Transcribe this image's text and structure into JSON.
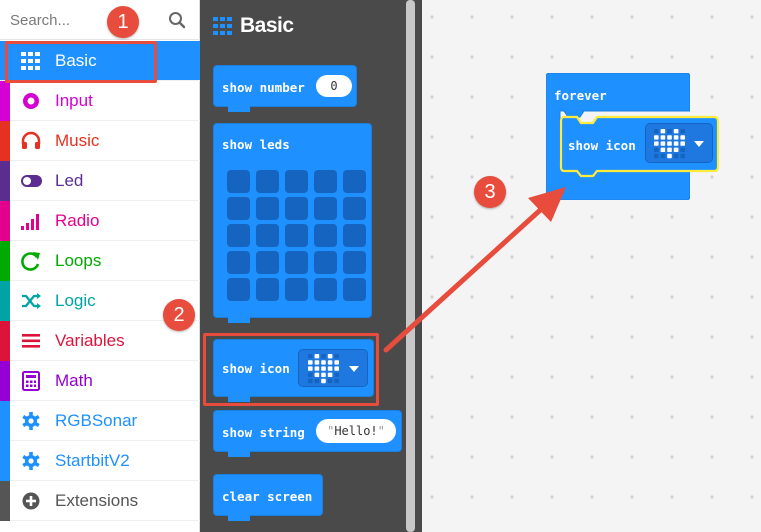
{
  "search": {
    "placeholder": "Search..."
  },
  "categories": [
    {
      "label": "Basic",
      "icon": "grid-icon",
      "color": "#1e90ff"
    },
    {
      "label": "Input",
      "icon": "circle-dot-icon",
      "color": "#d400d4"
    },
    {
      "label": "Music",
      "icon": "headphones-icon",
      "color": "#e63022"
    },
    {
      "label": "Led",
      "icon": "toggle-icon",
      "color": "#5c2d91"
    },
    {
      "label": "Radio",
      "icon": "signal-bars-icon",
      "color": "#e3008c"
    },
    {
      "label": "Loops",
      "icon": "refresh-icon",
      "color": "#00aa00"
    },
    {
      "label": "Logic",
      "icon": "shuffle-icon",
      "color": "#00a4a6"
    },
    {
      "label": "Variables",
      "icon": "list-icon",
      "color": "#dc143c"
    },
    {
      "label": "Math",
      "icon": "calculator-icon",
      "color": "#9400d3"
    },
    {
      "label": "RGBSonar",
      "icon": "gear-icon",
      "color": "#1e90ff"
    },
    {
      "label": "StartbitV2",
      "icon": "gear-icon",
      "color": "#1e90ff"
    },
    {
      "label": "Extensions",
      "icon": "plus-circle-icon",
      "color": "#555555"
    }
  ],
  "flyout": {
    "title": "Basic",
    "blocks": {
      "show_number": {
        "label": "show number",
        "value": "0"
      },
      "show_leds": {
        "label": "show leds"
      },
      "show_icon": {
        "label": "show icon"
      },
      "show_string": {
        "label": "show string",
        "value": "Hello!"
      },
      "clear_screen": {
        "label": "clear screen"
      }
    }
  },
  "workspace": {
    "forever": {
      "label": "forever"
    },
    "show_icon": {
      "label": "show icon"
    }
  },
  "annotations": {
    "step1": "1",
    "step2": "2",
    "step3": "3"
  },
  "colors": {
    "accent": "#1e90ff",
    "highlight": "#e74c3c",
    "flyout_bg": "#4a4a4a",
    "workspace_bg": "#f4f4f4",
    "selection": "#ffeb3b"
  }
}
